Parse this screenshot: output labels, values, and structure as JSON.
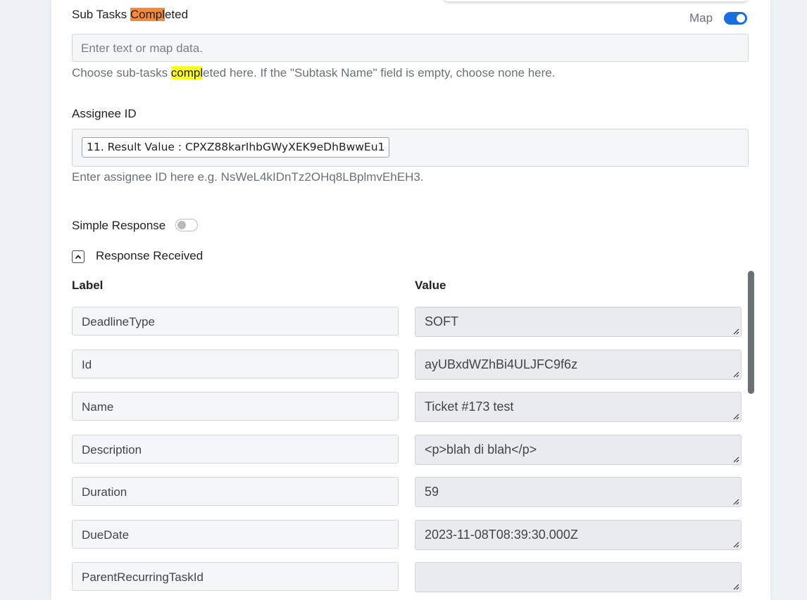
{
  "subtasks": {
    "label_prefix": "Sub Tasks ",
    "label_highlight": "Compl",
    "label_suffix": "eted",
    "map_label": "Map",
    "map_enabled": true,
    "placeholder": "Enter text or map data.",
    "help_prefix": "Choose sub-tasks ",
    "help_highlight": "compl",
    "help_suffix": "eted here. If the \"Subtask Name\" field is empty, choose none here."
  },
  "assignee": {
    "label": "Assignee ID",
    "token": "11. Result Value : CPXZ88karIhbGWyXEK9eDhBwwEu1",
    "help": "Enter assignee ID here e.g. NsWeL4kIDnTz2OHq8LBplmvEhEH3."
  },
  "simple_response": {
    "label": "Simple Response",
    "enabled": false
  },
  "response": {
    "title": "Response Received",
    "col_label": "Label",
    "col_value": "Value",
    "rows": [
      {
        "label": "DeadlineType",
        "value": "SOFT"
      },
      {
        "label": "Id",
        "value": "ayUBxdWZhBi4ULJFC9f6z"
      },
      {
        "label": "Name",
        "value": "Ticket #173 test"
      },
      {
        "label": "Description",
        "value": "<p>blah di blah</p>"
      },
      {
        "label": "Duration",
        "value": "59"
      },
      {
        "label": "DueDate",
        "value": "2023-11-08T08:39:30.000Z"
      },
      {
        "label": "ParentRecurringTaskId",
        "value": ""
      }
    ]
  },
  "colors": {
    "accent": "#1a6fdf",
    "highlight_orange": "#f48a3b",
    "highlight_yellow": "#fbff24"
  }
}
